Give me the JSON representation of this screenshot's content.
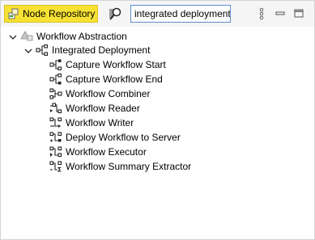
{
  "tab": {
    "label": "Node Repository",
    "icon": "node-repository-icon",
    "accent": "#f7e234"
  },
  "search": {
    "value": "integrated deployment",
    "filter_icon": "search-filter-icon"
  },
  "window_buttons": {
    "menu": "view-menu-icon",
    "minimize": "minimize-icon",
    "maximize": "maximize-icon"
  },
  "tree": {
    "root": {
      "label": "Workflow Abstraction",
      "icon": "category-icon",
      "expanded": true
    },
    "category": {
      "label": "Integrated Deployment",
      "icon": "category-node-icon",
      "expanded": true
    },
    "nodes": [
      {
        "label": "Capture Workflow Start",
        "icon": "capture-start-node-icon"
      },
      {
        "label": "Capture Workflow End",
        "icon": "capture-end-node-icon"
      },
      {
        "label": "Workflow Combiner",
        "icon": "workflow-combiner-node-icon"
      },
      {
        "label": "Workflow Reader",
        "icon": "workflow-reader-node-icon"
      },
      {
        "label": "Workflow Writer",
        "icon": "workflow-writer-node-icon"
      },
      {
        "label": "Deploy Workflow to Server",
        "icon": "deploy-workflow-node-icon"
      },
      {
        "label": "Workflow Executor",
        "icon": "workflow-executor-node-icon"
      },
      {
        "label": "Workflow Summary Extractor",
        "icon": "workflow-summary-node-icon"
      }
    ]
  }
}
